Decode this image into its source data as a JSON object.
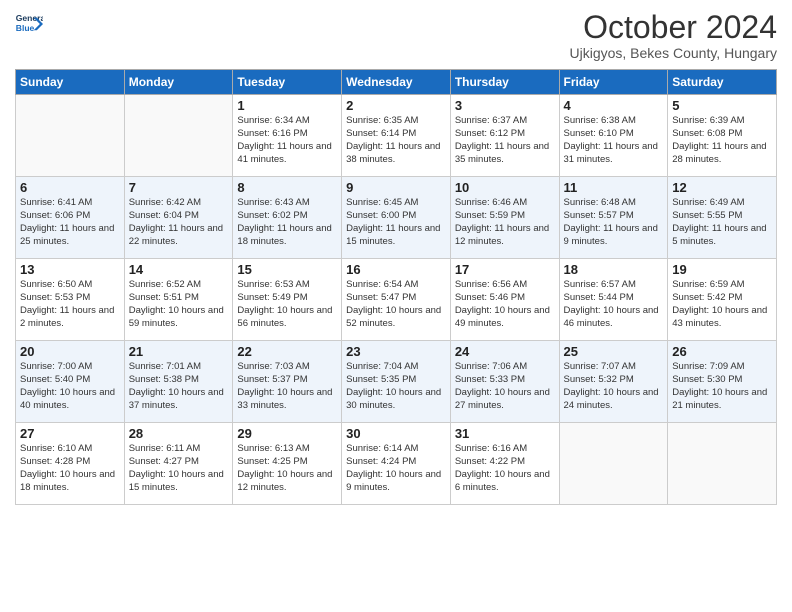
{
  "header": {
    "logo_line1": "General",
    "logo_line2": "Blue",
    "month": "October 2024",
    "location": "Ujkigyos, Bekes County, Hungary"
  },
  "days_of_week": [
    "Sunday",
    "Monday",
    "Tuesday",
    "Wednesday",
    "Thursday",
    "Friday",
    "Saturday"
  ],
  "weeks": [
    [
      {
        "num": "",
        "info": ""
      },
      {
        "num": "",
        "info": ""
      },
      {
        "num": "1",
        "info": "Sunrise: 6:34 AM\nSunset: 6:16 PM\nDaylight: 11 hours and 41 minutes."
      },
      {
        "num": "2",
        "info": "Sunrise: 6:35 AM\nSunset: 6:14 PM\nDaylight: 11 hours and 38 minutes."
      },
      {
        "num": "3",
        "info": "Sunrise: 6:37 AM\nSunset: 6:12 PM\nDaylight: 11 hours and 35 minutes."
      },
      {
        "num": "4",
        "info": "Sunrise: 6:38 AM\nSunset: 6:10 PM\nDaylight: 11 hours and 31 minutes."
      },
      {
        "num": "5",
        "info": "Sunrise: 6:39 AM\nSunset: 6:08 PM\nDaylight: 11 hours and 28 minutes."
      }
    ],
    [
      {
        "num": "6",
        "info": "Sunrise: 6:41 AM\nSunset: 6:06 PM\nDaylight: 11 hours and 25 minutes."
      },
      {
        "num": "7",
        "info": "Sunrise: 6:42 AM\nSunset: 6:04 PM\nDaylight: 11 hours and 22 minutes."
      },
      {
        "num": "8",
        "info": "Sunrise: 6:43 AM\nSunset: 6:02 PM\nDaylight: 11 hours and 18 minutes."
      },
      {
        "num": "9",
        "info": "Sunrise: 6:45 AM\nSunset: 6:00 PM\nDaylight: 11 hours and 15 minutes."
      },
      {
        "num": "10",
        "info": "Sunrise: 6:46 AM\nSunset: 5:59 PM\nDaylight: 11 hours and 12 minutes."
      },
      {
        "num": "11",
        "info": "Sunrise: 6:48 AM\nSunset: 5:57 PM\nDaylight: 11 hours and 9 minutes."
      },
      {
        "num": "12",
        "info": "Sunrise: 6:49 AM\nSunset: 5:55 PM\nDaylight: 11 hours and 5 minutes."
      }
    ],
    [
      {
        "num": "13",
        "info": "Sunrise: 6:50 AM\nSunset: 5:53 PM\nDaylight: 11 hours and 2 minutes."
      },
      {
        "num": "14",
        "info": "Sunrise: 6:52 AM\nSunset: 5:51 PM\nDaylight: 10 hours and 59 minutes."
      },
      {
        "num": "15",
        "info": "Sunrise: 6:53 AM\nSunset: 5:49 PM\nDaylight: 10 hours and 56 minutes."
      },
      {
        "num": "16",
        "info": "Sunrise: 6:54 AM\nSunset: 5:47 PM\nDaylight: 10 hours and 52 minutes."
      },
      {
        "num": "17",
        "info": "Sunrise: 6:56 AM\nSunset: 5:46 PM\nDaylight: 10 hours and 49 minutes."
      },
      {
        "num": "18",
        "info": "Sunrise: 6:57 AM\nSunset: 5:44 PM\nDaylight: 10 hours and 46 minutes."
      },
      {
        "num": "19",
        "info": "Sunrise: 6:59 AM\nSunset: 5:42 PM\nDaylight: 10 hours and 43 minutes."
      }
    ],
    [
      {
        "num": "20",
        "info": "Sunrise: 7:00 AM\nSunset: 5:40 PM\nDaylight: 10 hours and 40 minutes."
      },
      {
        "num": "21",
        "info": "Sunrise: 7:01 AM\nSunset: 5:38 PM\nDaylight: 10 hours and 37 minutes."
      },
      {
        "num": "22",
        "info": "Sunrise: 7:03 AM\nSunset: 5:37 PM\nDaylight: 10 hours and 33 minutes."
      },
      {
        "num": "23",
        "info": "Sunrise: 7:04 AM\nSunset: 5:35 PM\nDaylight: 10 hours and 30 minutes."
      },
      {
        "num": "24",
        "info": "Sunrise: 7:06 AM\nSunset: 5:33 PM\nDaylight: 10 hours and 27 minutes."
      },
      {
        "num": "25",
        "info": "Sunrise: 7:07 AM\nSunset: 5:32 PM\nDaylight: 10 hours and 24 minutes."
      },
      {
        "num": "26",
        "info": "Sunrise: 7:09 AM\nSunset: 5:30 PM\nDaylight: 10 hours and 21 minutes."
      }
    ],
    [
      {
        "num": "27",
        "info": "Sunrise: 6:10 AM\nSunset: 4:28 PM\nDaylight: 10 hours and 18 minutes."
      },
      {
        "num": "28",
        "info": "Sunrise: 6:11 AM\nSunset: 4:27 PM\nDaylight: 10 hours and 15 minutes."
      },
      {
        "num": "29",
        "info": "Sunrise: 6:13 AM\nSunset: 4:25 PM\nDaylight: 10 hours and 12 minutes."
      },
      {
        "num": "30",
        "info": "Sunrise: 6:14 AM\nSunset: 4:24 PM\nDaylight: 10 hours and 9 minutes."
      },
      {
        "num": "31",
        "info": "Sunrise: 6:16 AM\nSunset: 4:22 PM\nDaylight: 10 hours and 6 minutes."
      },
      {
        "num": "",
        "info": ""
      },
      {
        "num": "",
        "info": ""
      }
    ]
  ]
}
